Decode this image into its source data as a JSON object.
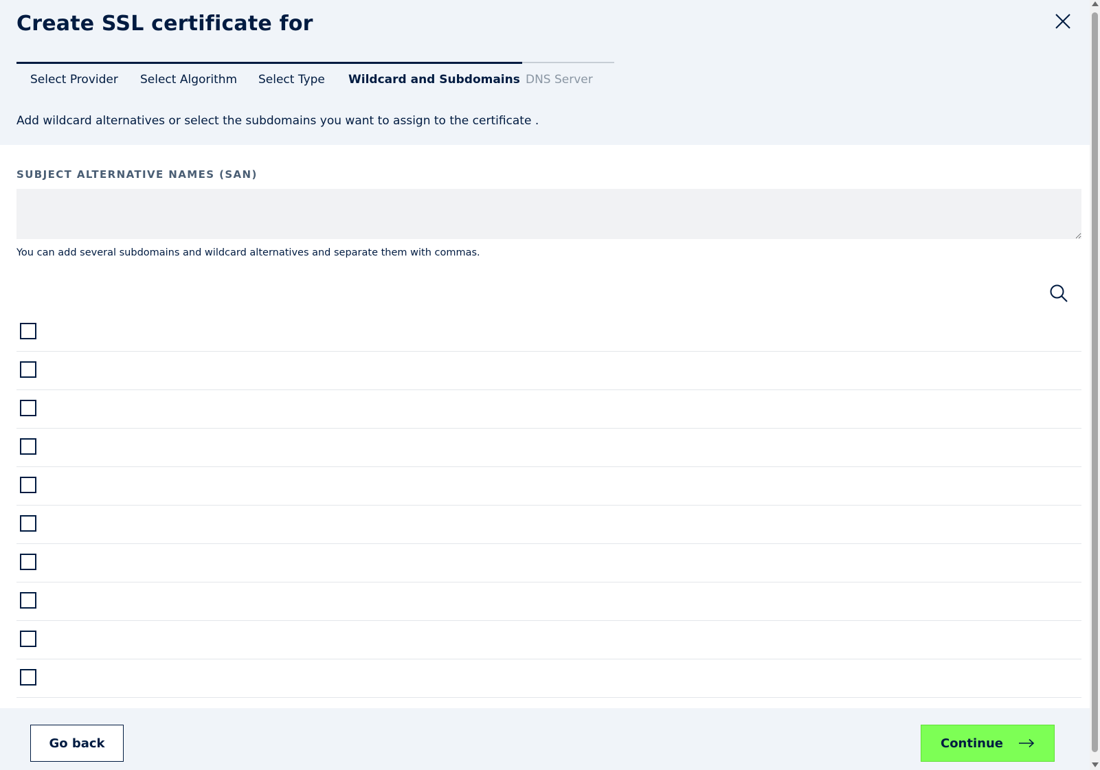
{
  "dialog": {
    "title": "Create SSL certificate for",
    "close_icon": "close-icon"
  },
  "stepper": {
    "progress_fraction": 0.846,
    "steps": [
      {
        "label": "Select Provider",
        "state": "completed"
      },
      {
        "label": "Select Algorithm",
        "state": "completed"
      },
      {
        "label": "Select Type",
        "state": "completed"
      },
      {
        "label": "Wildcard and Subdomains",
        "state": "active"
      },
      {
        "label": "DNS Server",
        "state": "disabled"
      }
    ]
  },
  "intro": "Add wildcard alternatives or select the subdomains you want to assign to the certificate .",
  "san": {
    "label": "SUBJECT ALTERNATIVE NAMES (SAN)",
    "value": "",
    "helper": "You can add several subdomains and wildcard alternatives and separate them with commas."
  },
  "search": {
    "icon": "search-icon"
  },
  "subdomains": {
    "rows": [
      {
        "checked": false,
        "label": ""
      },
      {
        "checked": false,
        "label": ""
      },
      {
        "checked": false,
        "label": ""
      },
      {
        "checked": false,
        "label": ""
      },
      {
        "checked": false,
        "label": ""
      },
      {
        "checked": false,
        "label": ""
      },
      {
        "checked": false,
        "label": ""
      },
      {
        "checked": false,
        "label": ""
      },
      {
        "checked": false,
        "label": ""
      },
      {
        "checked": false,
        "label": ""
      }
    ]
  },
  "footer": {
    "back_label": "Go back",
    "continue_label": "Continue",
    "continue_icon": "arrow-right-icon"
  },
  "colors": {
    "primary_text": "#001b41",
    "accent_green": "#7dff55",
    "panel_background": "#f0f4f9"
  }
}
